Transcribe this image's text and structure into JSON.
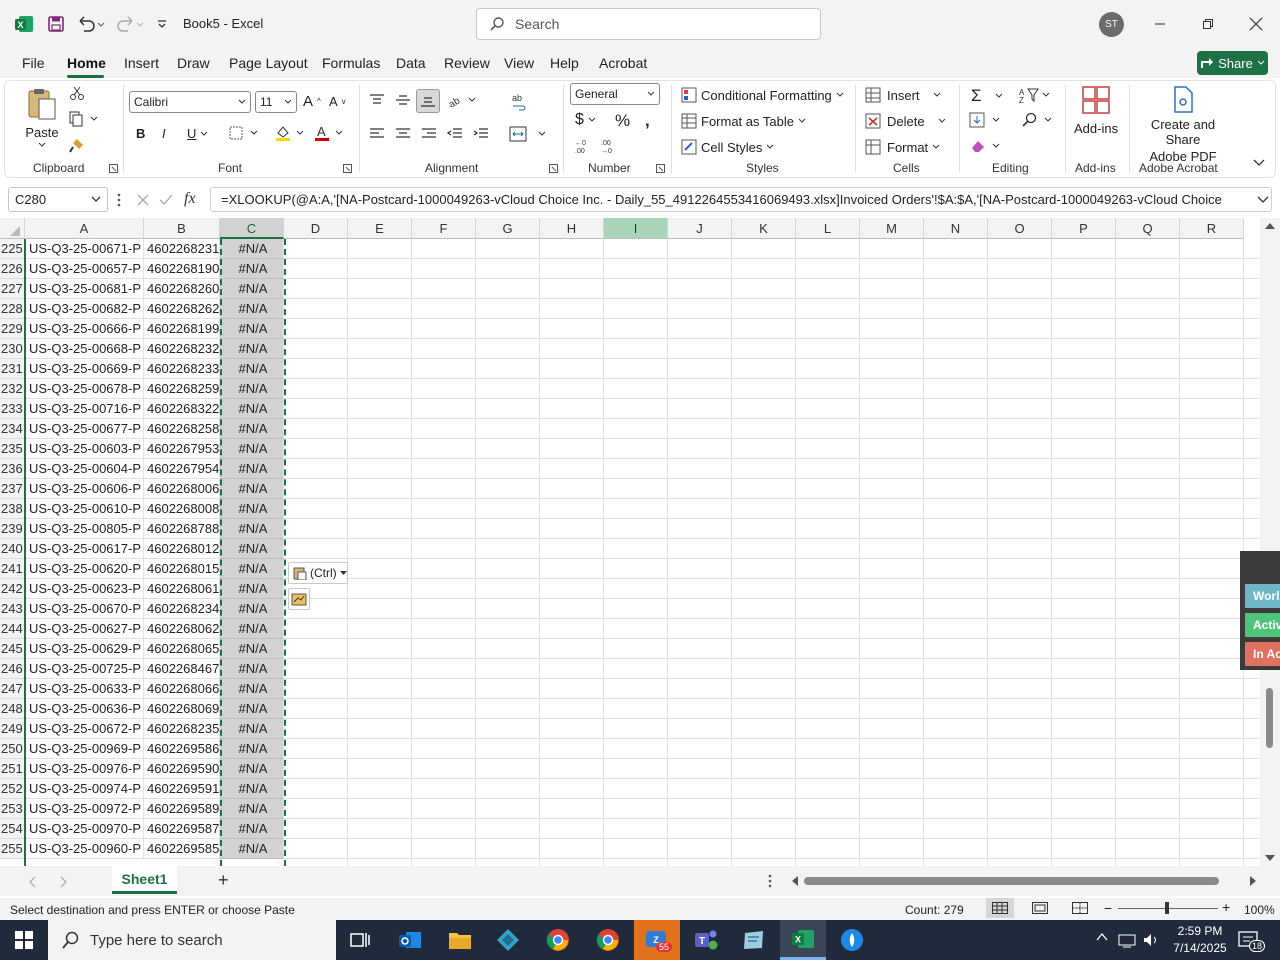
{
  "title": {
    "doc": "Book5",
    "app": "Excel",
    "search_placeholder": "Search",
    "avatar": "ST"
  },
  "menu": [
    "File",
    "Home",
    "Insert",
    "Draw",
    "Page Layout",
    "Formulas",
    "Data",
    "Review",
    "View",
    "Help",
    "Acrobat"
  ],
  "share_label": "Share",
  "ribbon": {
    "clipboard": {
      "paste": "Paste",
      "label": "Clipboard"
    },
    "font": {
      "name": "Calibri",
      "size": "11",
      "label": "Font"
    },
    "alignment": {
      "label": "Alignment"
    },
    "number": {
      "format": "General",
      "label": "Number"
    },
    "styles": {
      "conditional": "Conditional Formatting",
      "table": "Format as Table",
      "cell": "Cell Styles",
      "label": "Styles"
    },
    "cells": {
      "insert": "Insert",
      "delete": "Delete",
      "format": "Format",
      "label": "Cells"
    },
    "editing": {
      "label": "Editing"
    },
    "addins": {
      "btn": "Add-ins",
      "label": "Add-ins"
    },
    "acrobat": {
      "line1": "Create and Share",
      "line2": "Adobe PDF",
      "label": "Adobe Acrobat"
    }
  },
  "namebox": "C280",
  "formula": "=XLOOKUP(@A:A,'[NA-Postcard-1000049263-vCloud Choice Inc. - Daily_55_4912264553416069493.xlsx]Invoiced Orders'!$A:$A,'[NA-Postcard-1000049263-vCloud Choice",
  "columns": [
    "A",
    "B",
    "C",
    "D",
    "E",
    "F",
    "G",
    "H",
    "I",
    "J",
    "K",
    "L",
    "M",
    "N",
    "O",
    "P",
    "Q",
    "R"
  ],
  "rows": [
    {
      "n": "225",
      "a": "US-Q3-25-00671-P",
      "b": "4602268231",
      "c": "#N/A"
    },
    {
      "n": "226",
      "a": "US-Q3-25-00657-P",
      "b": "4602268190",
      "c": "#N/A"
    },
    {
      "n": "227",
      "a": "US-Q3-25-00681-P",
      "b": "4602268260",
      "c": "#N/A"
    },
    {
      "n": "228",
      "a": "US-Q3-25-00682-P",
      "b": "4602268262",
      "c": "#N/A"
    },
    {
      "n": "229",
      "a": "US-Q3-25-00666-P",
      "b": "4602268199",
      "c": "#N/A"
    },
    {
      "n": "230",
      "a": "US-Q3-25-00668-P",
      "b": "4602268232",
      "c": "#N/A"
    },
    {
      "n": "231",
      "a": "US-Q3-25-00669-P",
      "b": "4602268233",
      "c": "#N/A"
    },
    {
      "n": "232",
      "a": "US-Q3-25-00678-P",
      "b": "4602268259",
      "c": "#N/A"
    },
    {
      "n": "233",
      "a": "US-Q3-25-00716-P",
      "b": "4602268322",
      "c": "#N/A"
    },
    {
      "n": "234",
      "a": "US-Q3-25-00677-P",
      "b": "4602268258",
      "c": "#N/A"
    },
    {
      "n": "235",
      "a": "US-Q3-25-00603-P",
      "b": "4602267953",
      "c": "#N/A"
    },
    {
      "n": "236",
      "a": "US-Q3-25-00604-P",
      "b": "4602267954",
      "c": "#N/A"
    },
    {
      "n": "237",
      "a": "US-Q3-25-00606-P",
      "b": "4602268006",
      "c": "#N/A"
    },
    {
      "n": "238",
      "a": "US-Q3-25-00610-P",
      "b": "4602268008",
      "c": "#N/A"
    },
    {
      "n": "239",
      "a": "US-Q3-25-00805-P",
      "b": "4602268788",
      "c": "#N/A"
    },
    {
      "n": "240",
      "a": "US-Q3-25-00617-P",
      "b": "4602268012",
      "c": "#N/A"
    },
    {
      "n": "241",
      "a": "US-Q3-25-00620-P",
      "b": "4602268015",
      "c": "#N/A"
    },
    {
      "n": "242",
      "a": "US-Q3-25-00623-P",
      "b": "4602268061",
      "c": "#N/A"
    },
    {
      "n": "243",
      "a": "US-Q3-25-00670-P",
      "b": "4602268234",
      "c": "#N/A"
    },
    {
      "n": "244",
      "a": "US-Q3-25-00627-P",
      "b": "4602268062",
      "c": "#N/A"
    },
    {
      "n": "245",
      "a": "US-Q3-25-00629-P",
      "b": "4602268065",
      "c": "#N/A"
    },
    {
      "n": "246",
      "a": "US-Q3-25-00725-P",
      "b": "4602268467",
      "c": "#N/A"
    },
    {
      "n": "247",
      "a": "US-Q3-25-00633-P",
      "b": "4602268066",
      "c": "#N/A"
    },
    {
      "n": "248",
      "a": "US-Q3-25-00636-P",
      "b": "4602268069",
      "c": "#N/A"
    },
    {
      "n": "249",
      "a": "US-Q3-25-00672-P",
      "b": "4602268235",
      "c": "#N/A"
    },
    {
      "n": "250",
      "a": "US-Q3-25-00969-P",
      "b": "4602269586",
      "c": "#N/A"
    },
    {
      "n": "251",
      "a": "US-Q3-25-00976-P",
      "b": "4602269590",
      "c": "#N/A"
    },
    {
      "n": "252",
      "a": "US-Q3-25-00974-P",
      "b": "4602269591",
      "c": "#N/A"
    },
    {
      "n": "253",
      "a": "US-Q3-25-00972-P",
      "b": "4602269589",
      "c": "#N/A"
    },
    {
      "n": "254",
      "a": "US-Q3-25-00970-P",
      "b": "4602269587",
      "c": "#N/A"
    },
    {
      "n": "255",
      "a": "US-Q3-25-00960-P",
      "b": "4602269585",
      "c": "#N/A"
    }
  ],
  "paste_options": "(Ctrl)",
  "side_panel": [
    "Worl",
    "Activ",
    "In Ac"
  ],
  "sheet_tab": "Sheet1",
  "status": {
    "message": "Select destination and press ENTER or choose Paste",
    "count": "Count: 279",
    "zoom": "100%"
  },
  "taskbar": {
    "search": "Type here to search",
    "time": "2:59 PM",
    "date": "7/14/2025",
    "notif": "18",
    "badge": "55"
  }
}
